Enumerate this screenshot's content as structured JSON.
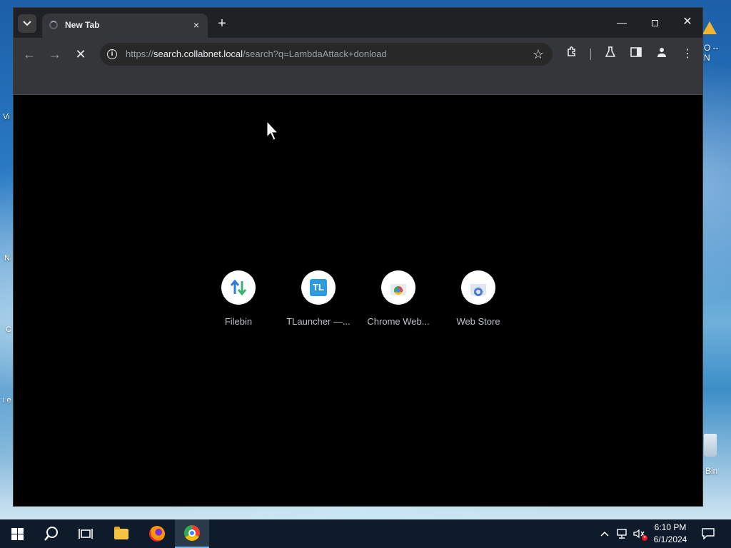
{
  "desktop": {
    "right_labels": [
      "O --",
      "N"
    ],
    "recycle_bin_label": "Bin",
    "left_labels": [
      "Vi",
      "N",
      "C",
      "i e"
    ]
  },
  "browser": {
    "tab": {
      "title": "New Tab",
      "close_icon": "×"
    },
    "new_tab_icon": "+",
    "window_controls": {
      "minimize": "—",
      "close": "✕"
    },
    "toolbar": {
      "back_icon": "←",
      "forward_icon": "→",
      "stop_icon": "✕",
      "url_scheme": "https://",
      "url_host": "search.collabnet.local",
      "url_path": "/search?q=LambdaAttack+donload",
      "star_icon": "☆",
      "menu_icon": "⋮"
    },
    "shortcuts": [
      {
        "label": "Filebin",
        "icon": "transfer-arrows-icon"
      },
      {
        "label": "TLauncher —...",
        "icon": "tl-icon",
        "icon_text": "TL"
      },
      {
        "label": "Chrome Web...",
        "icon": "chrome-web-store-icon"
      },
      {
        "label": "Web Store",
        "icon": "web-store-icon"
      }
    ]
  },
  "taskbar": {
    "clock_time": "6:10 PM",
    "clock_date": "6/1/2024",
    "tray_chevron": "^"
  },
  "colors": {
    "window_bg": "#000000",
    "chrome_frame": "#202124",
    "toolbar": "#35363a",
    "taskbar": "#0d1b2a"
  }
}
